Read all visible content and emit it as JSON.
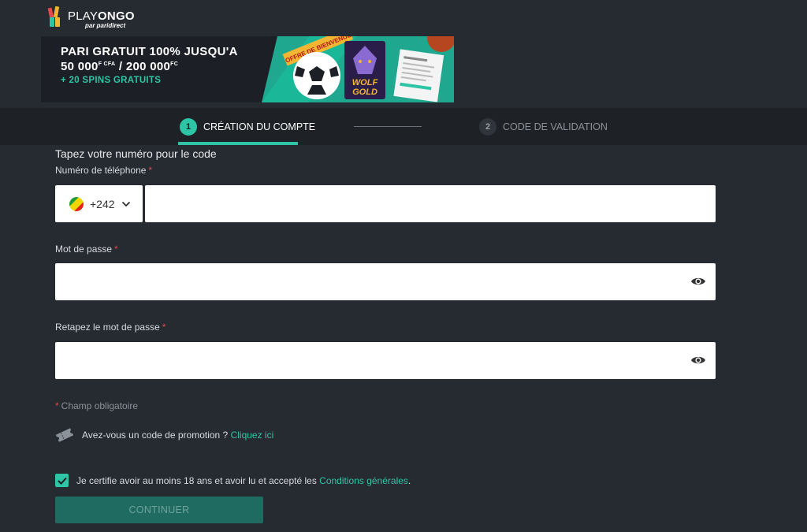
{
  "brand": {
    "name_light": "PLAY",
    "name_bold": "ONGO",
    "tagline": "par paridirect"
  },
  "banner": {
    "line1": "PARI GRATUIT 100% JUSQU'A",
    "line2_a": "50 000",
    "line2_sup_a": "F CFA",
    "line2_b": " / 200 000",
    "line2_sup_b": "FC",
    "line3": "+ 20 SPINS GRATUITS",
    "ribbon": "OFFRE DE BIENVENUE",
    "game_title_1": "WOLF",
    "game_title_2": "GOLD"
  },
  "steps": [
    {
      "number": "1",
      "label": "CRÉATION DU COMPTE",
      "active": true
    },
    {
      "number": "2",
      "label": "CODE DE VALIDATION",
      "active": false
    }
  ],
  "form": {
    "intro": "Tapez votre numéro pour le code",
    "phone_label": "Numéro de téléphone",
    "phone_prefix": "+242",
    "phone_value": "",
    "password_label": "Mot de passe",
    "password_value": "",
    "confirm_label": "Retapez le mot de passe",
    "confirm_value": "",
    "required_marker": "*",
    "required_note": "Champ obligatoire",
    "promo_text": "Avez-vous un code de promotion ?",
    "promo_link": "Cliquez ici",
    "certify_text": "Je certifie avoir au moins 18 ans et avoir lu et accepté les",
    "certify_link": "Conditions générales",
    "certify_end": ".",
    "certify_checked": true,
    "continue_label": "CONTINUER"
  },
  "colors": {
    "accent": "#2ec4a6",
    "background": "#262a31",
    "required": "#e5484d"
  }
}
